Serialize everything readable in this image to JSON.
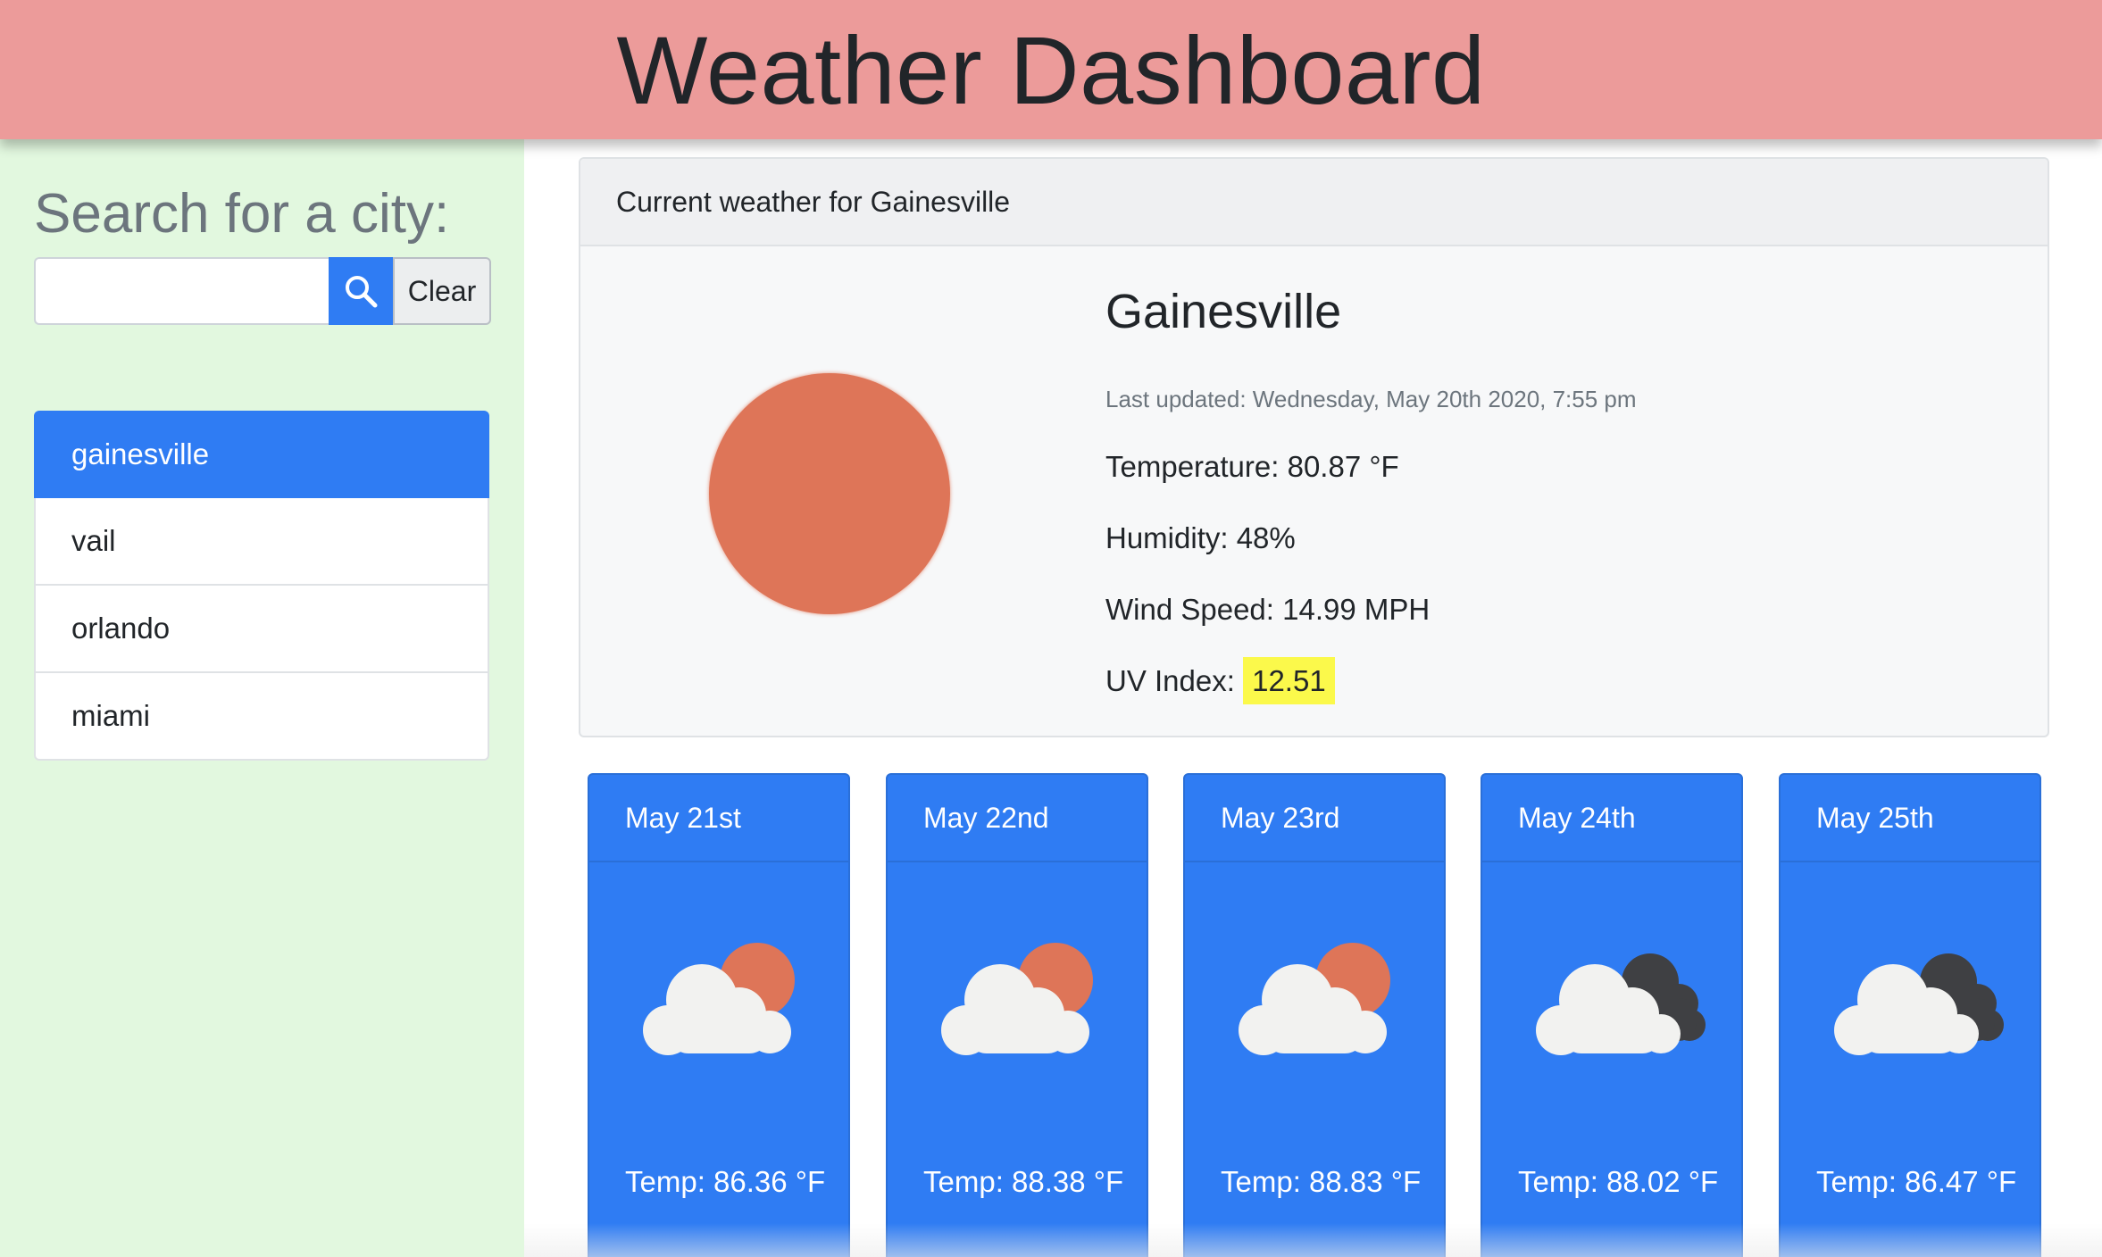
{
  "header": {
    "title": "Weather Dashboard"
  },
  "sidebar": {
    "search_title": "Search for a city:",
    "search_input_value": "",
    "search_icon": "search-icon",
    "clear_label": "Clear",
    "history": [
      "gainesville",
      "vail",
      "orlando",
      "miami"
    ],
    "active_index": 0
  },
  "current": {
    "header": "Current weather for Gainesville",
    "city": "Gainesville",
    "updated": "Last updated: Wednesday, May 20th 2020, 7:55 pm",
    "temperature": "Temperature: 80.87 °F",
    "humidity": "Humidity: 48%",
    "wind": "Wind Speed: 14.99 MPH",
    "uv_label": "UV Index:",
    "uv_value": "12.51",
    "icon": "clear-sun-icon"
  },
  "forecast": [
    {
      "date": "May 21st",
      "temp": "Temp: 86.36 °F",
      "icon": "partly-cloudy-sun-icon"
    },
    {
      "date": "May 22nd",
      "temp": "Temp: 88.38 °F",
      "icon": "partly-cloudy-sun-icon"
    },
    {
      "date": "May 23rd",
      "temp": "Temp: 88.83 °F",
      "icon": "partly-cloudy-sun-icon"
    },
    {
      "date": "May 24th",
      "temp": "Temp: 88.02 °F",
      "icon": "broken-clouds-icon"
    },
    {
      "date": "May 25th",
      "temp": "Temp: 86.47 °F",
      "icon": "broken-clouds-icon"
    }
  ],
  "colors": {
    "header_bg": "#ec9b9a",
    "sidebar_bg": "#e2f8df",
    "primary": "#2f7cf3",
    "sun": "#de7558",
    "uv_highlight": "#fbf94b",
    "dark_cloud": "#3f4043",
    "light_cloud": "#f2f2f0"
  }
}
